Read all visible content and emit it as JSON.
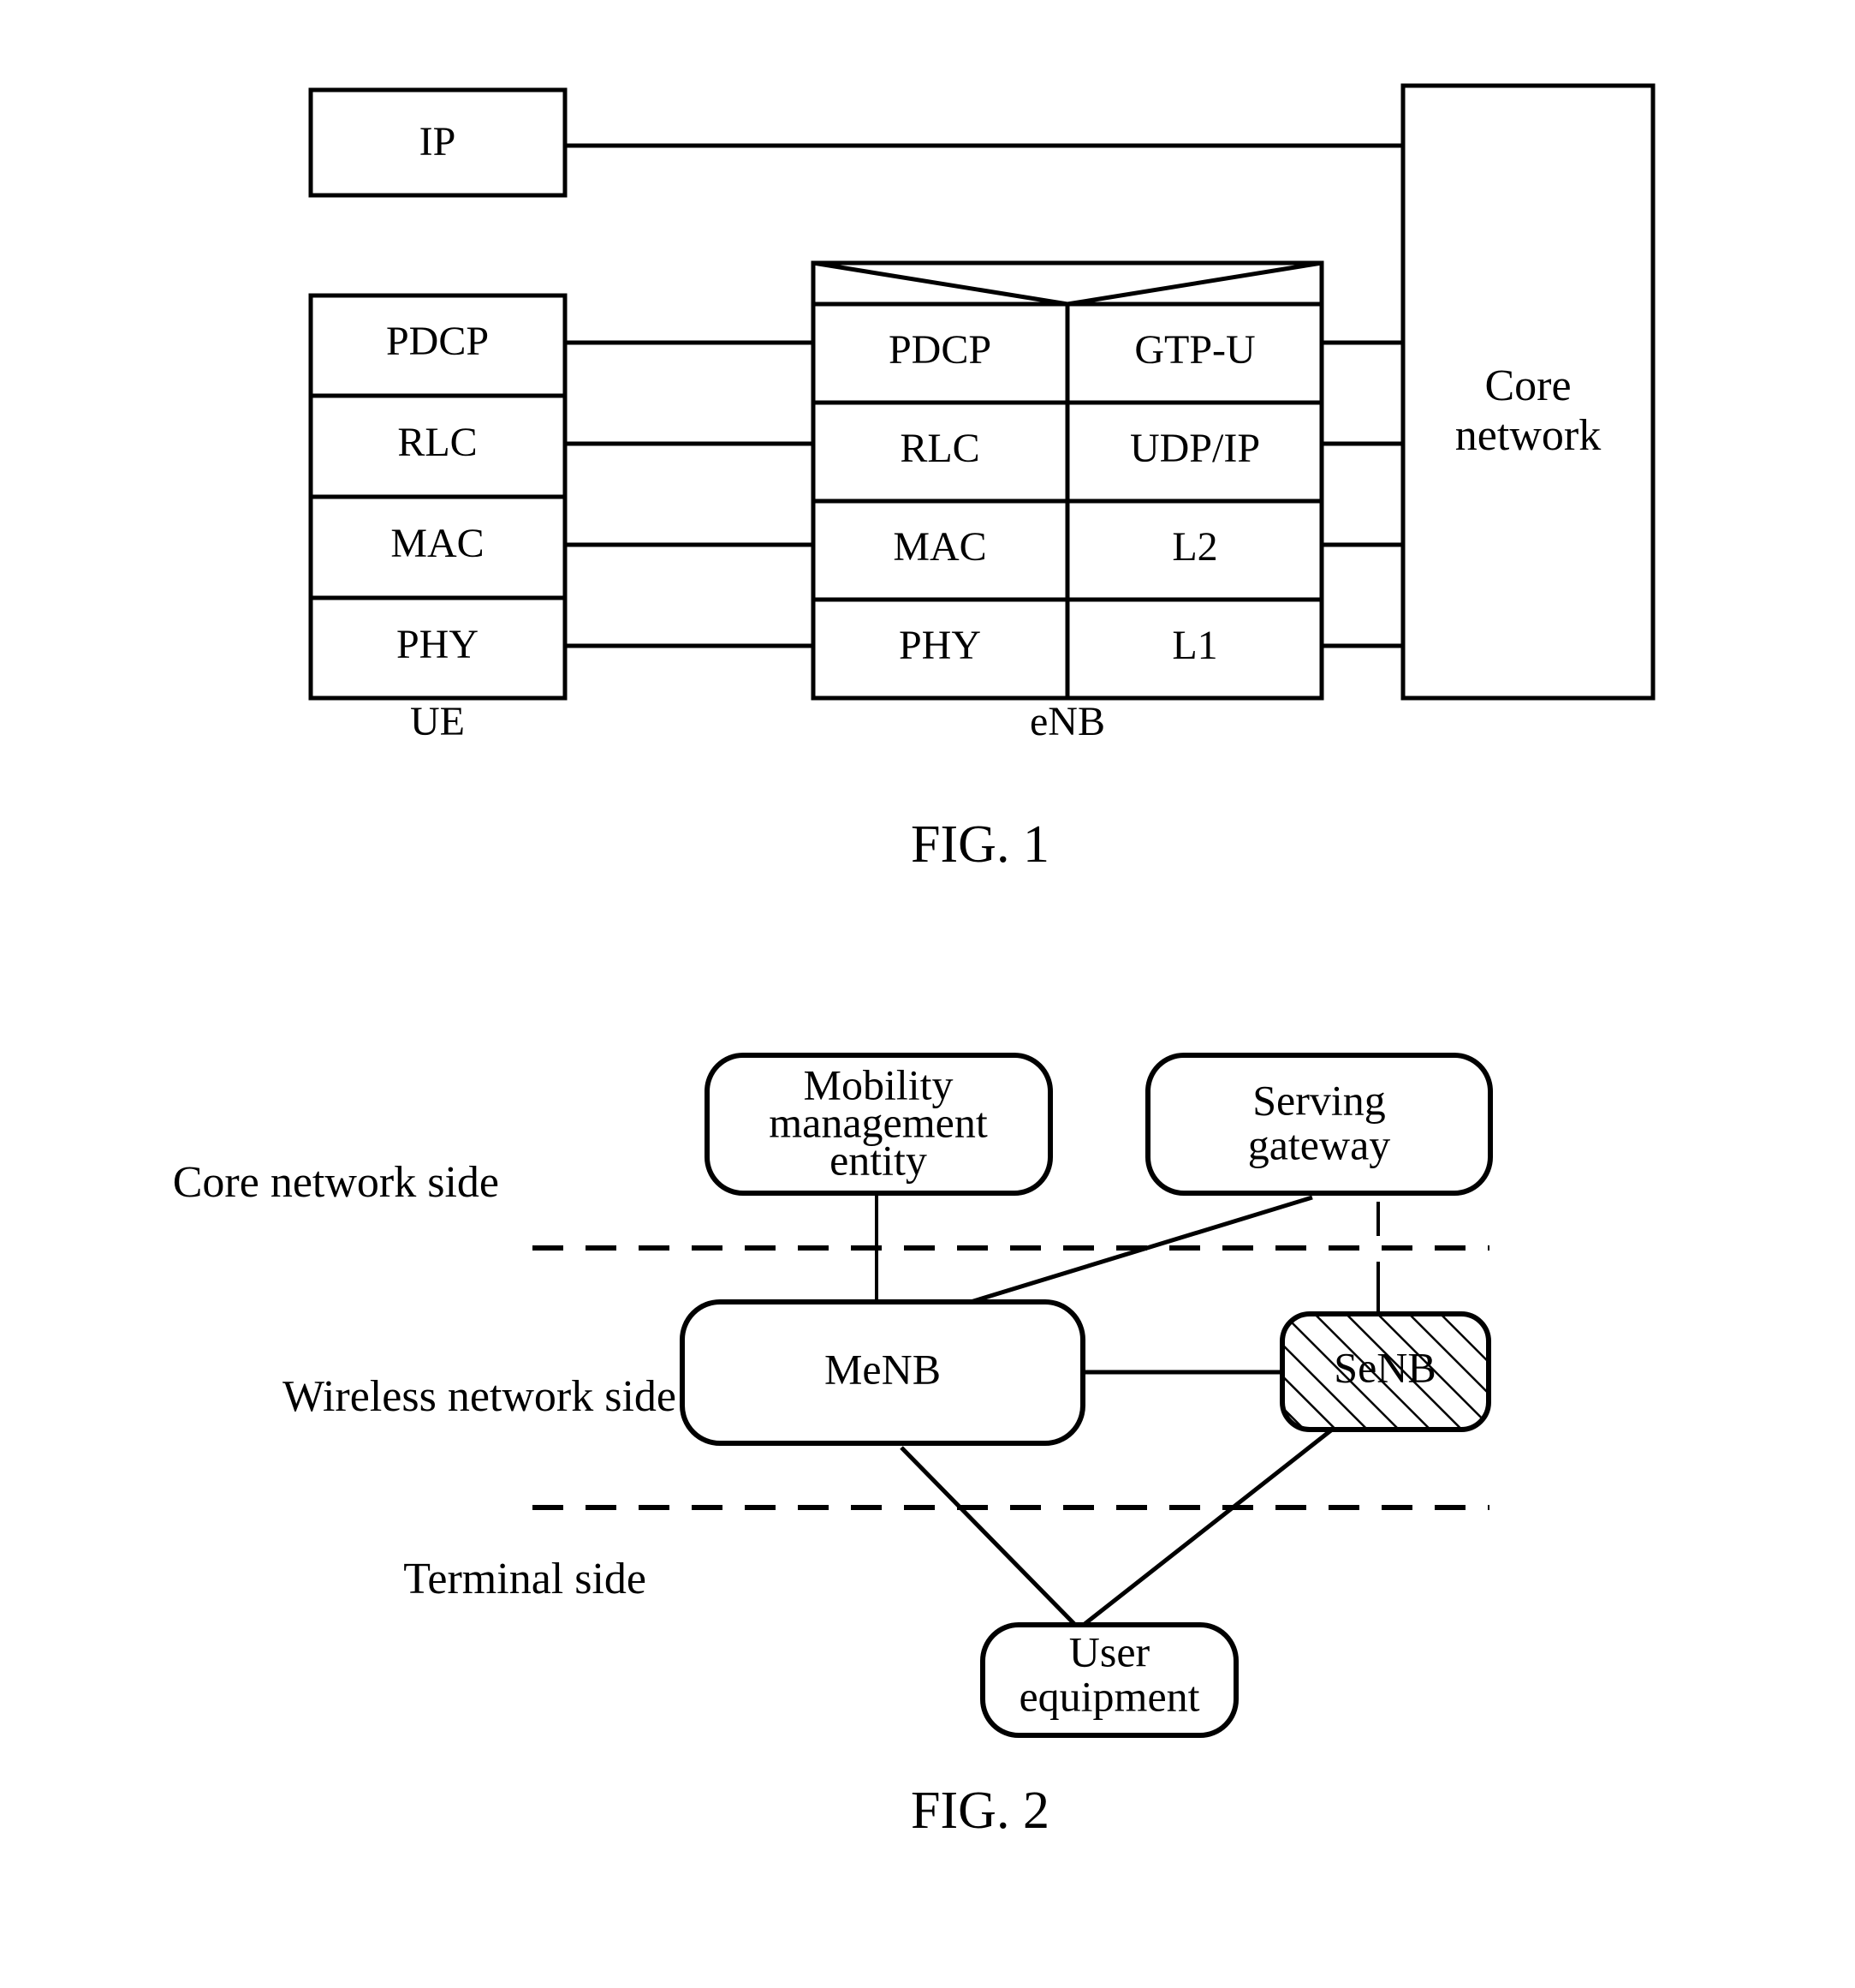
{
  "document": {
    "type": "patent-figures",
    "figures": [
      {
        "caption": "FIG. 1",
        "title": "LTE user plane protocol stack"
      },
      {
        "caption": "FIG. 2",
        "title": "Dual connectivity network architecture"
      }
    ]
  },
  "figure1": {
    "caption": "FIG. 1",
    "ip_box": {
      "label": "IP"
    },
    "ue_stack": {
      "label": "UE",
      "layers": [
        "PDCP",
        "RLC",
        "MAC",
        "PHY"
      ]
    },
    "enb_stack": {
      "label": "eNB",
      "left_column": [
        "PDCP",
        "RLC",
        "MAC",
        "PHY"
      ],
      "right_column": [
        "GTP-U",
        "UDP/IP",
        "L2",
        "L1"
      ]
    },
    "core_network": {
      "label_line1": "Core",
      "label_line2": "network"
    }
  },
  "figure2": {
    "caption": "FIG. 2",
    "side_labels": [
      "Core network side",
      "Wireless network side",
      "Terminal side"
    ],
    "nodes": {
      "mme": {
        "lines": [
          "Mobility",
          "management",
          "entity"
        ],
        "shape": "rounded-rectangle",
        "fill": "none"
      },
      "sgw": {
        "lines": [
          "Serving",
          "gateway"
        ],
        "shape": "rounded-rectangle",
        "fill": "none"
      },
      "menb": {
        "lines": [
          "MeNB"
        ],
        "shape": "rounded-rectangle",
        "fill": "none"
      },
      "senb": {
        "lines": [
          "SeNB"
        ],
        "shape": "rounded-rectangle",
        "fill": "diagonal-hatch"
      },
      "ue": {
        "lines": [
          "User",
          "equipment"
        ],
        "shape": "rounded-rectangle",
        "fill": "none"
      }
    }
  },
  "colors": {
    "background": "#ffffff",
    "stroke": "#000000",
    "text": "#000000"
  }
}
